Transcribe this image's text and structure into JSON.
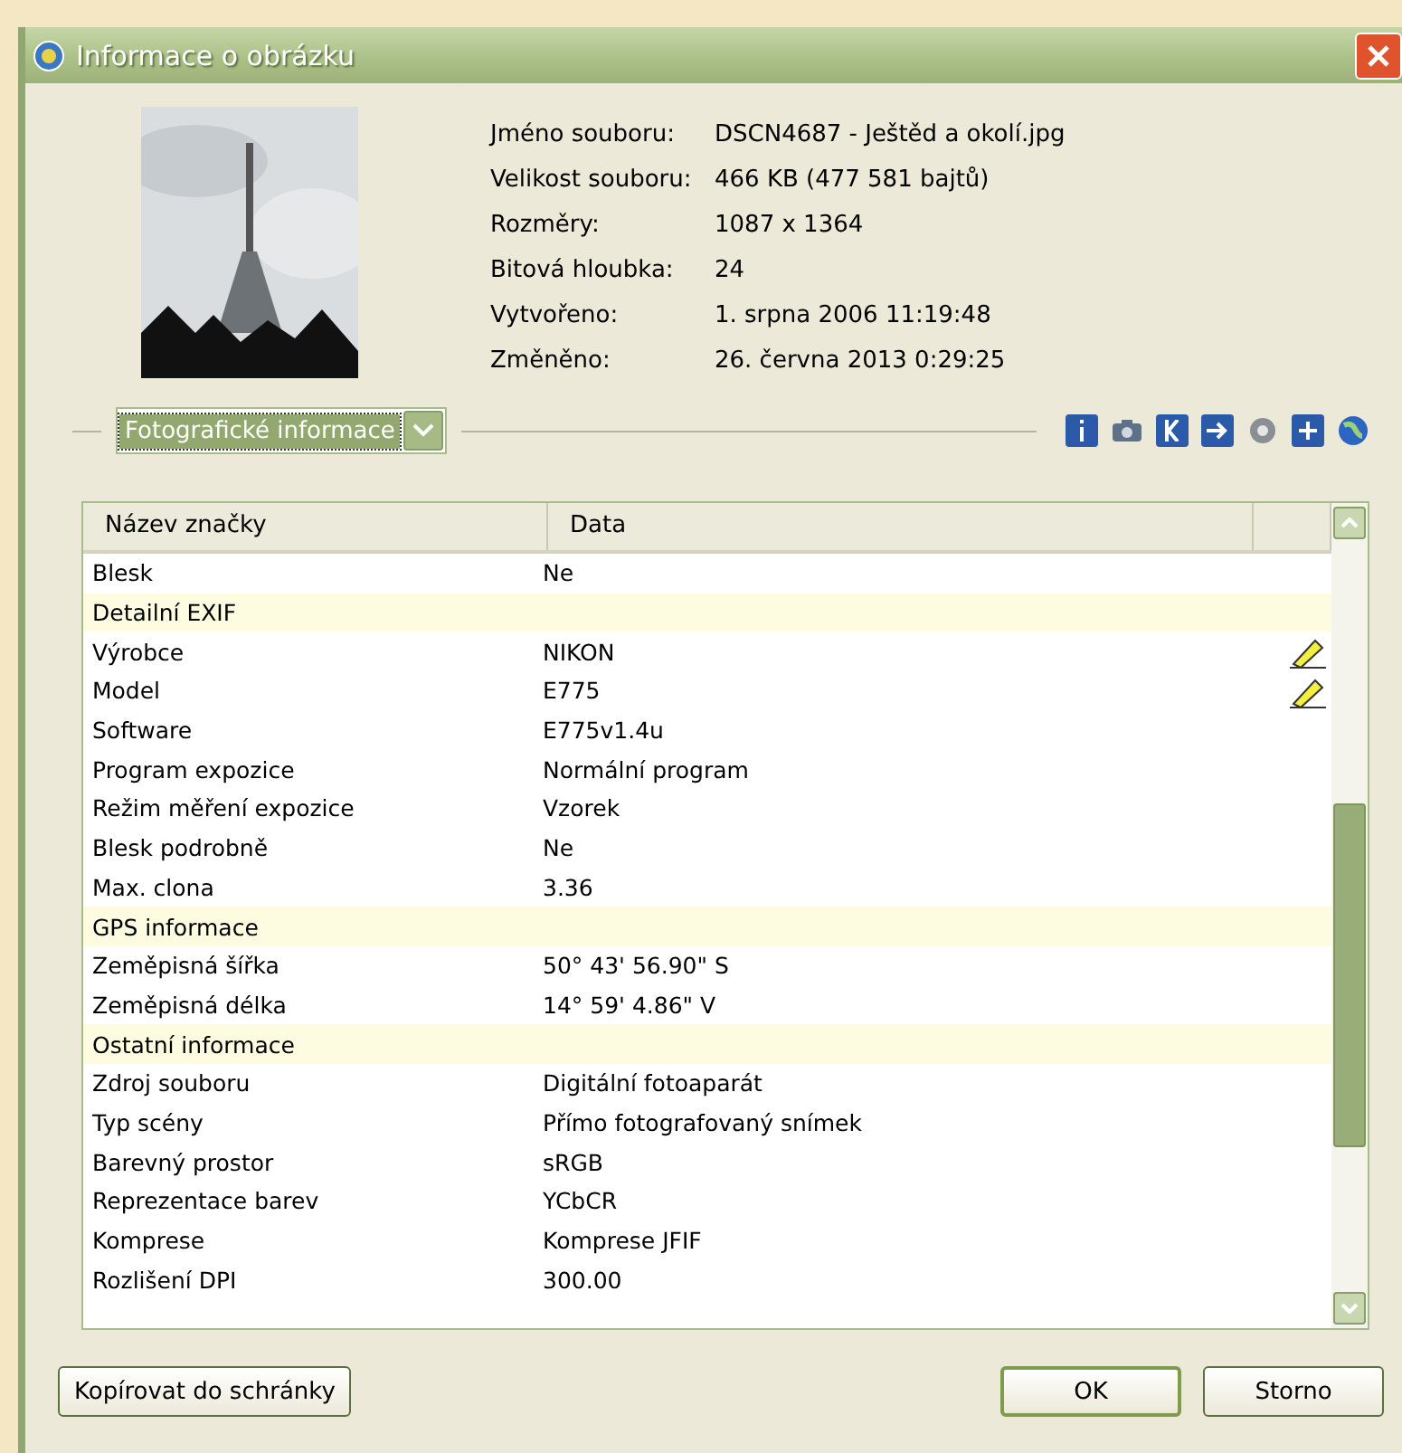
{
  "window": {
    "title": "Informace o obrázku"
  },
  "file_info": [
    {
      "label": "Jméno souboru:",
      "value": "DSCN4687 - Ještěd a okolí.jpg"
    },
    {
      "label": "Velikost souboru:",
      "value": "466 KB (477 581 bajtů)"
    },
    {
      "label": "Rozměry:",
      "value": "1087 x 1364"
    },
    {
      "label": "Bitová hloubka:",
      "value": "24"
    },
    {
      "label": "Vytvořeno:",
      "value": "1. srpna 2006 11:19:48"
    },
    {
      "label": "Změněno:",
      "value": "26. června 2013 0:29:25"
    }
  ],
  "view_select": {
    "value": "Fotografické informace"
  },
  "table": {
    "columns": [
      "Název značky",
      "Data"
    ],
    "rows": [
      {
        "kind": "data",
        "name": "Blesk",
        "value": "Ne",
        "editable": false
      },
      {
        "kind": "section",
        "name": "Detailní EXIF"
      },
      {
        "kind": "data",
        "name": "Výrobce",
        "value": "NIKON",
        "editable": true
      },
      {
        "kind": "data",
        "name": "Model",
        "value": "E775",
        "editable": true
      },
      {
        "kind": "data",
        "name": "Software",
        "value": "E775v1.4u",
        "editable": false
      },
      {
        "kind": "data",
        "name": "Program expozice",
        "value": "Normální program",
        "editable": false
      },
      {
        "kind": "data",
        "name": "Režim měření expozice",
        "value": "Vzorek",
        "editable": false
      },
      {
        "kind": "data",
        "name": "Blesk podrobně",
        "value": "Ne",
        "editable": false
      },
      {
        "kind": "data",
        "name": "Max. clona",
        "value": "3.36",
        "editable": false
      },
      {
        "kind": "section",
        "name": "GPS informace"
      },
      {
        "kind": "data",
        "name": "Zeměpisná šířka",
        "value": "50° 43' 56.90\" S",
        "editable": false
      },
      {
        "kind": "data",
        "name": "Zeměpisná délka",
        "value": "14° 59' 4.86\" V",
        "editable": false
      },
      {
        "kind": "section",
        "name": "Ostatní informace"
      },
      {
        "kind": "data",
        "name": "Zdroj souboru",
        "value": "Digitální fotoaparát",
        "editable": false
      },
      {
        "kind": "data",
        "name": "Typ scény",
        "value": "Přímo fotografovaný snímek",
        "editable": false
      },
      {
        "kind": "data",
        "name": "Barevný prostor",
        "value": "sRGB",
        "editable": false
      },
      {
        "kind": "data",
        "name": "Reprezentace barev",
        "value": "YCbCR",
        "editable": false
      },
      {
        "kind": "data",
        "name": "Komprese",
        "value": "Komprese JFIF",
        "editable": false
      },
      {
        "kind": "data",
        "name": "Rozlišení DPI",
        "value": "300.00",
        "editable": false
      }
    ]
  },
  "buttons": [
    {
      "label": "Kopírovat do schránky",
      "kind": "left"
    },
    {
      "label": "OK",
      "kind": "default"
    },
    {
      "label": "Storno",
      "kind": "normal"
    }
  ]
}
